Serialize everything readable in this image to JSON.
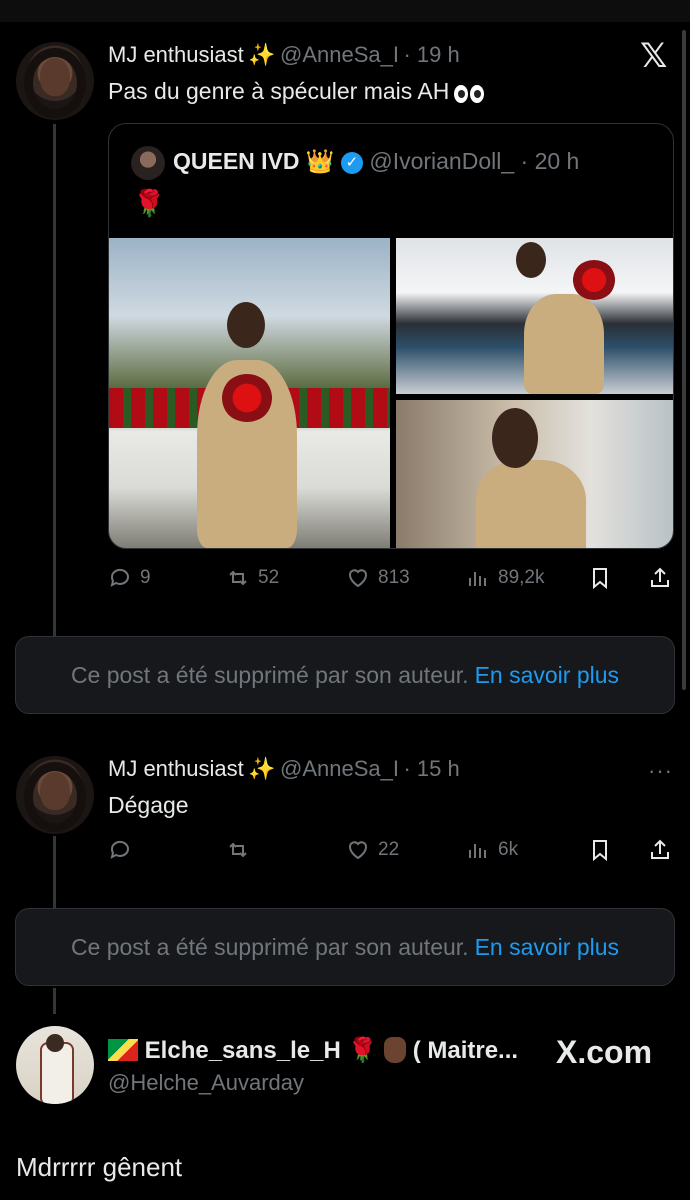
{
  "tweet1": {
    "author_name": "MJ enthusiast",
    "author_emoji": "✨",
    "handle": "@AnneSa_I",
    "time": "· 19 h",
    "text": "Pas du genre à spéculer mais AH",
    "text_emoji": "eyes-emoji",
    "quote": {
      "name": "QUEEN IVD",
      "crown": "👑",
      "handle": "@IvorianDoll_",
      "time": "· 20 h",
      "text": "🌹"
    },
    "stats": {
      "replies": "9",
      "reposts": "52",
      "likes": "813",
      "views": "89,2k"
    }
  },
  "deleted1": {
    "text": "Ce post a été supprimé par son auteur.",
    "link": "En savoir plus"
  },
  "tweet2": {
    "author_name": "MJ enthusiast",
    "author_emoji": "✨",
    "handle": "@AnneSa_I",
    "time": "· 15 h",
    "more": "···",
    "text": "Dégage",
    "stats": {
      "replies": "",
      "reposts": "",
      "likes": "22",
      "views": "6k"
    }
  },
  "deleted2": {
    "text": "Ce post a été supprimé par son auteur.",
    "link": "En savoir plus"
  },
  "tweet3": {
    "display_name": "Elche_sans_le_H",
    "rose": "🌹",
    "display_suffix": "( Maitre...",
    "handle": "@Helche_Auvarday",
    "brand": "X.com",
    "text": "Mdrrrrr gênent"
  },
  "colors": {
    "background": "#000000",
    "accent": "#1d9bf0",
    "muted": "#71767b"
  }
}
